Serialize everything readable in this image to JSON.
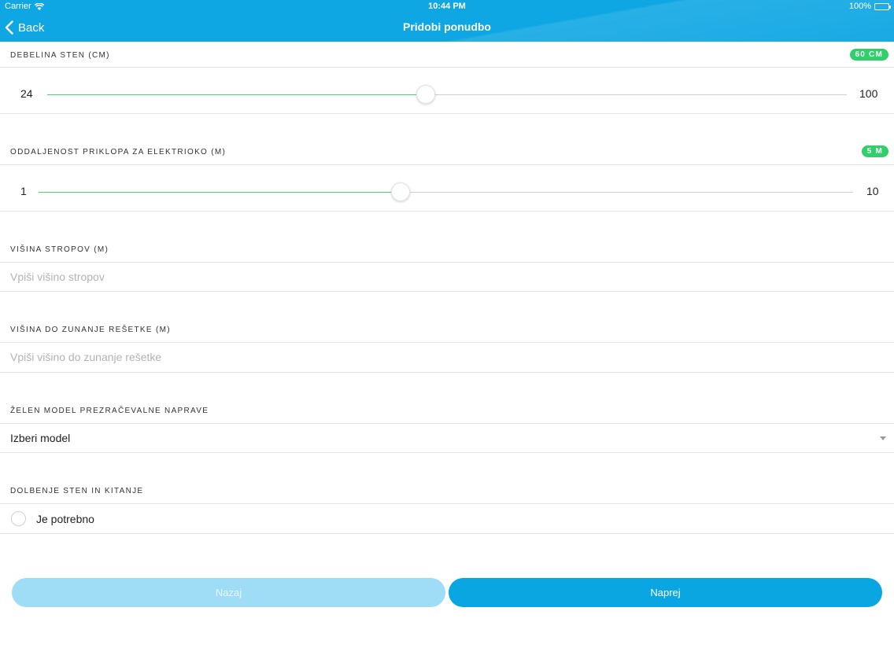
{
  "status_bar": {
    "carrier": "Carrier",
    "time": "10:44 PM",
    "battery": "100%"
  },
  "nav": {
    "back_label": "Back",
    "title": "Pridobi ponudbo"
  },
  "colors": {
    "primary": "#0fa7e3",
    "badge": "#2fd06a",
    "track_fill": "#4cd07a",
    "back_button": "#9fdcf5"
  },
  "wall_thickness": {
    "label": "DEBELINA STEN (CM)",
    "badge": "60 CM",
    "min": "24",
    "max": "100",
    "value": 60
  },
  "power_distance": {
    "label": "ODDALJENOST PRIKLOPA ZA ELEKTRIOKO (M)",
    "badge": "5 M",
    "min": "1",
    "max": "10",
    "value": 5
  },
  "ceiling_height": {
    "label": "VIŠINA STROPOV (M)",
    "placeholder": "Vpiši višino stropov",
    "value": ""
  },
  "grille_height": {
    "label": "VIŠINA DO ZUNANJE REŠETKE (M)",
    "placeholder": "Vpiši višino do zunanje rešetke",
    "value": ""
  },
  "device_model": {
    "label": "ŽELEN MODEL PREZRAČEVALNE NAPRAVE",
    "selected": "Izberi model"
  },
  "wall_drilling": {
    "label": "DOLBENJE STEN IN KITANJE",
    "option": "Je potrebno",
    "checked": false
  },
  "buttons": {
    "back": "Nazaj",
    "next": "Naprej"
  }
}
